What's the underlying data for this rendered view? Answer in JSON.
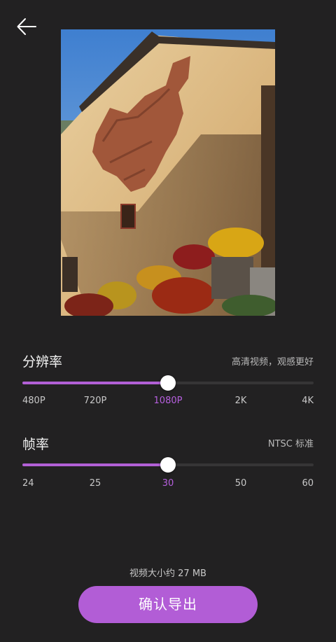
{
  "nav": {
    "back_icon": "arrow-left-icon"
  },
  "preview": {
    "description": "Old house wall with Chinese map-shaped brick patch and flowers"
  },
  "resolution": {
    "title": "分辨率",
    "hint": "高清视频，观感更好",
    "options": [
      "480P",
      "720P",
      "1080P",
      "2K",
      "4K"
    ],
    "selected_index": 2,
    "level": 0.5
  },
  "framerate": {
    "title": "帧率",
    "hint": "NTSC 标准",
    "options": [
      "24",
      "25",
      "30",
      "50",
      "60"
    ],
    "selected_index": 2,
    "level": 0.5
  },
  "footer": {
    "size_text": "视频大小约 27 MB",
    "export_label": "确认导出"
  },
  "colors": {
    "accent": "#b25dd6",
    "background": "#222122",
    "track": "#363536"
  }
}
